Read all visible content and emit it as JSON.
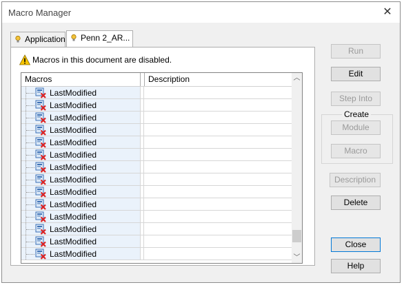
{
  "window": {
    "title": "Macro Manager"
  },
  "tabs": [
    {
      "label": "Application"
    },
    {
      "label": "Penn 2_AR..."
    }
  ],
  "warning": {
    "text": "Macros in this document are disabled."
  },
  "list": {
    "columns": [
      "Macros",
      "Description"
    ],
    "rows": [
      "LastModified",
      "LastModified",
      "LastModified",
      "LastModified",
      "LastModified",
      "LastModified",
      "LastModified",
      "LastModified",
      "LastModified",
      "LastModified",
      "LastModified",
      "LastModified",
      "LastModified",
      "LastModified"
    ]
  },
  "buttons": {
    "run": "Run",
    "edit": "Edit",
    "step_into": "Step Into",
    "create_label": "Create",
    "module": "Module",
    "macro": "Macro",
    "description": "Description",
    "delete": "Delete",
    "close": "Close",
    "help": "Help"
  },
  "colors": {
    "accent": "#0078d7",
    "warning": "#f7c500",
    "macro_cell_bg": "#eaf2fb"
  }
}
